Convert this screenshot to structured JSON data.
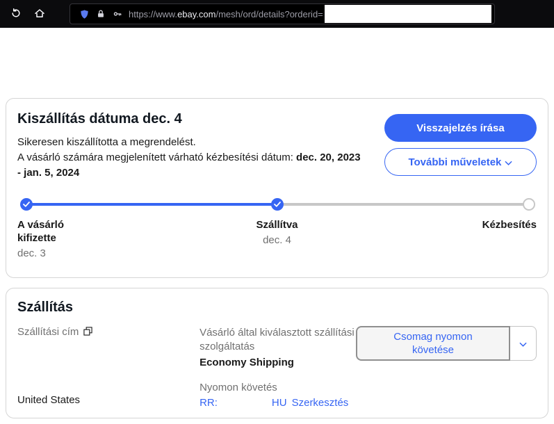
{
  "colors": {
    "accent_blue": "#3665f3",
    "link_blue": "#3665f3",
    "progress_pending_gray": "#c7c7c7"
  },
  "browser": {
    "url_prefix": "https://www.",
    "url_domain": "ebay.com",
    "url_path": "/mesh/ord/details?orderid="
  },
  "status_card": {
    "title": "Kiszállítás dátuma dec. 4",
    "line1": "Sikeresen kiszállította a megrendelést.",
    "line2_normal": "A vásárló számára megjelenített várható kézbesítési dátum: ",
    "line2_bold": "dec. 20, 2023",
    "line3_bold": "- jan. 5, 2024",
    "primary_button": "Visszajelzés írása",
    "secondary_button": "További műveletek",
    "steps": [
      {
        "label": "A vásárló kifizette",
        "date": "dec. 3"
      },
      {
        "label": "Szállítva",
        "date": "dec. 4"
      },
      {
        "label": "Kézbesítés",
        "date": ""
      }
    ]
  },
  "shipping_card": {
    "title": "Szállítás",
    "address_label": "Szállítási cím",
    "country": "United States",
    "service_label": "Vásárló által kiválasztott szállítási szolgáltatás",
    "service_value": "Economy Shipping",
    "tracking_label": "Nyomon követés",
    "tracking_prefix": "RR:",
    "tracking_suffix": "HU",
    "edit_link": "Szerkesztés",
    "track_button": "Csomag nyomon követése"
  }
}
